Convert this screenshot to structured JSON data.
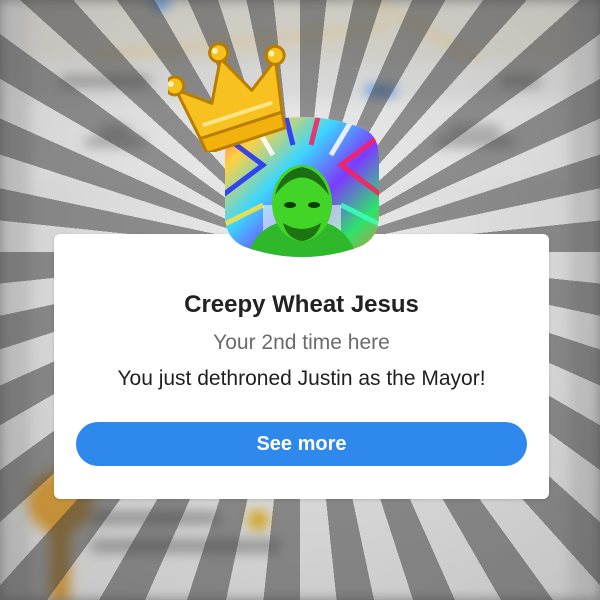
{
  "popup": {
    "user_name": "Creepy Wheat Jesus",
    "visit_count_text": "Your 2nd time here",
    "message": "You just dethroned Justin as the Mayor!",
    "button_label": "See more"
  },
  "icons": {
    "crown": "crown-icon",
    "avatar": "user-avatar"
  },
  "colors": {
    "accent_button": "#2f88ec",
    "crown_gold": "#f7c21f",
    "card_background": "#ffffff"
  }
}
